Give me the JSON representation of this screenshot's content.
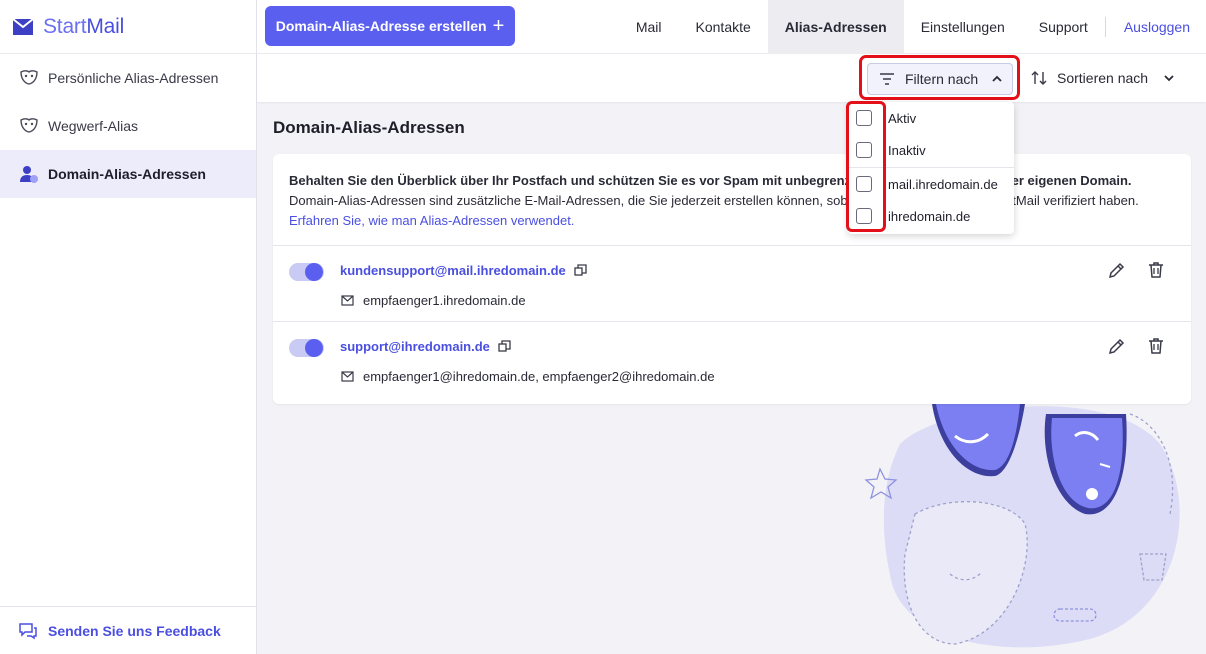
{
  "app": {
    "brand_start": "Start",
    "brand_mail": "Mail"
  },
  "sidebar": {
    "items": [
      {
        "label": "Persönliche Alias-Adressen",
        "icon": "mask-icon",
        "active": false
      },
      {
        "label": "Wegwerf-Alias",
        "icon": "mask-icon",
        "active": false
      },
      {
        "label": "Domain-Alias-Adressen",
        "icon": "user-domain-icon",
        "active": true
      }
    ],
    "feedback_label": "Senden Sie uns Feedback"
  },
  "header": {
    "create_button": "Domain-Alias-Adresse erstellen",
    "nav": [
      {
        "label": "Mail",
        "active": false
      },
      {
        "label": "Kontakte",
        "active": false
      },
      {
        "label": "Alias-Adressen",
        "active": true
      },
      {
        "label": "Einstellungen",
        "active": false
      },
      {
        "label": "Support",
        "active": false
      }
    ],
    "logout": "Ausloggen"
  },
  "toolbar": {
    "filter_label": "Filtern nach",
    "sort_label": "Sortieren nach"
  },
  "main": {
    "title": "Domain-Alias-Adressen",
    "intro_bold": "Behalten Sie den Überblick über Ihr Postfach und schützen Sie es vor Spam mit unbegrenzten Alias-Adressen auf Ihrer eigenen Domain.",
    "intro_text": " Domain-Alias-Adressen sind zusätzliche E-Mail-Adressen, die Sie jederzeit erstellen können, sobald Sie eine Domain mit StartMail verifiziert haben. ",
    "intro_link": "Erfahren Sie, wie man Alias-Adressen verwendet.",
    "aliases": [
      {
        "address": "kundensupport@mail.ihredomain.de",
        "recipients": "empfaenger1.ihredomain.de",
        "enabled": true
      },
      {
        "address": "support@ihredomain.de",
        "recipients": "empfaenger1@ihredomain.de, empfaenger2@ihredomain.de",
        "enabled": true
      }
    ]
  },
  "filter_menu": {
    "items": [
      {
        "label": "Aktiv",
        "checked": false
      },
      {
        "label": "Inaktiv",
        "checked": false
      },
      {
        "label": "mail.ihredomain.de",
        "checked": false
      },
      {
        "label": "ihredomain.de",
        "checked": false
      }
    ]
  },
  "colors": {
    "accent": "#5b5ff0",
    "highlight": "#e3101a"
  }
}
